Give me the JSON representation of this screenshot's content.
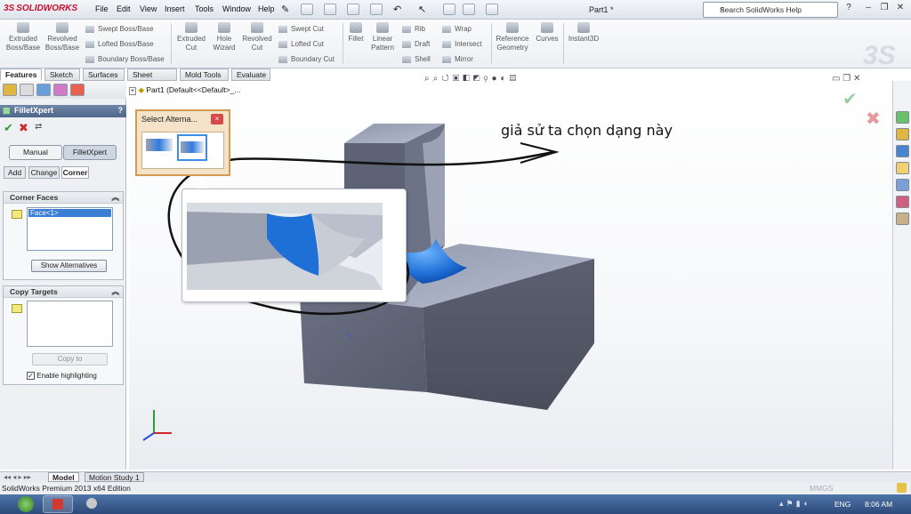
{
  "app": {
    "logo_text": "SOLIDWORKS",
    "document_title": "Part1 *"
  },
  "menu": [
    "File",
    "Edit",
    "View",
    "Insert",
    "Tools",
    "Window",
    "Help"
  ],
  "help_search": {
    "placeholder": "Search SolidWorks Help"
  },
  "command_manager": {
    "big_buttons": [
      {
        "label": "Extruded\nBoss/Base",
        "icon": "extruded-boss-icon"
      },
      {
        "label": "Revolved\nBoss/Base",
        "icon": "revolved-boss-icon"
      },
      {
        "label": "Extruded\nCut",
        "icon": "extruded-cut-icon"
      },
      {
        "label": "Hole\nWizard",
        "icon": "hole-wizard-icon"
      },
      {
        "label": "Revolved\nCut",
        "icon": "revolved-cut-icon"
      },
      {
        "label": "Fillet",
        "icon": "fillet-icon"
      },
      {
        "label": "Linear\nPattern",
        "icon": "linear-pattern-icon"
      },
      {
        "label": "Reference\nGeometry",
        "icon": "reference-geometry-icon"
      },
      {
        "label": "Curves",
        "icon": "curves-icon"
      },
      {
        "label": "Instant3D",
        "icon": "instant3d-icon"
      }
    ],
    "small_buttons": {
      "swept_boss": "Swept Boss/Base",
      "lofted_boss": "Lofted Boss/Base",
      "boundary_boss": "Boundary Boss/Base",
      "swept_cut": "Swept Cut",
      "lofted_cut": "Lofted Cut",
      "boundary_cut": "Boundary Cut",
      "rib": "Rib",
      "draft": "Draft",
      "shell": "Shell",
      "wrap": "Wrap",
      "intersect": "Intersect",
      "mirror": "Mirror"
    }
  },
  "tabs": [
    "Features",
    "Sketch",
    "Surfaces",
    "Sheet Metal",
    "Mold Tools",
    "Evaluate"
  ],
  "active_tab": "Features",
  "tree": {
    "root": "Part1  (Default<<Default>_..."
  },
  "property_manager": {
    "title": "FilletXpert",
    "mode_buttons": [
      "Manual",
      "FilletXpert"
    ],
    "active_mode": "FilletXpert",
    "subtabs": [
      "Add",
      "Change",
      "Corner"
    ],
    "active_subtab": "Corner",
    "corner_faces": {
      "heading": "Corner Faces",
      "items": [
        "Face<1>"
      ],
      "button": "Show Alternatives"
    },
    "copy_targets": {
      "heading": "Copy Targets",
      "items": [],
      "button": "Copy to",
      "checkbox_label": "Enable highlighting",
      "checkbox_checked": true
    }
  },
  "popup": {
    "title": "Select Alterna...",
    "close": "×"
  },
  "annotation": "giả sử ta chọn dạng này",
  "bottom_tabs": [
    "Model",
    "Motion Study 1"
  ],
  "active_bottom_tab": "Model",
  "status": {
    "edition": "SolidWorks Premium 2013 x64 Edition",
    "units": "MMGS"
  },
  "taskbar": {
    "language": "ENG",
    "time": "8:06 AM"
  },
  "colors": {
    "fillet_blue": "#1e6fd6",
    "popup_border": "#d39a51",
    "accept_green": "#2e9e3b",
    "cancel_red": "#cc2a2a"
  }
}
